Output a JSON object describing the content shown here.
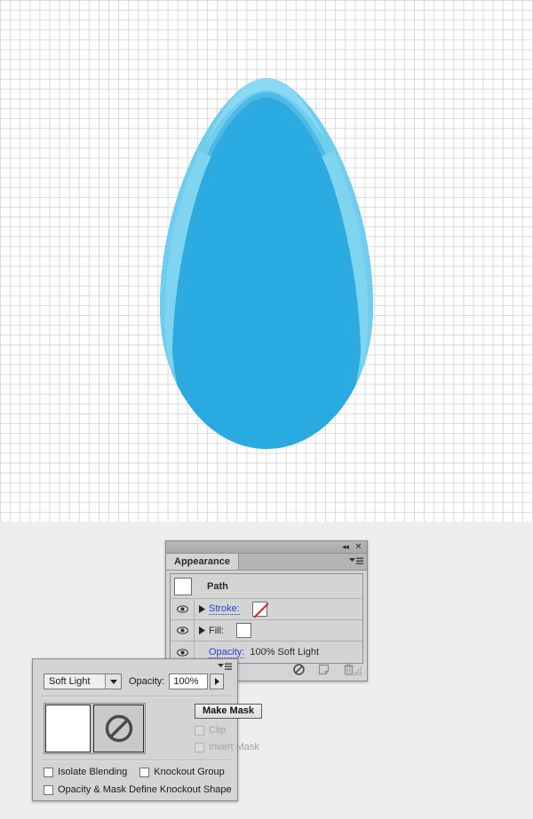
{
  "canvas": {
    "background_color": "#ffffff",
    "grid_color": "#d9d9d9",
    "grid_size_px": 11,
    "workspace_color": "#eeeeee"
  },
  "artwork": {
    "name": "egg-shape",
    "fill_color": "#29abe2",
    "highlight_color": "#6fcdee",
    "rim_color": "#4cc0ea",
    "description": "blue egg shape with light highlight rim"
  },
  "appearance_panel": {
    "titlebar": {
      "collapse_icon": "collapse-icon",
      "collapse_glyph": "◂◂",
      "close_icon": "close-icon",
      "close_glyph": "✕"
    },
    "tab_label": "Appearance",
    "menu_icon": "panel-menu-icon",
    "rows": [
      {
        "type": "object",
        "label": "Path",
        "has_thumbnail": true
      },
      {
        "type": "attribute",
        "label": "Stroke:",
        "linked": true,
        "visible": true,
        "expandable": true,
        "swatch": "none"
      },
      {
        "type": "attribute",
        "label": "Fill:",
        "linked": false,
        "visible": true,
        "expandable": true,
        "swatch": "white"
      },
      {
        "type": "attribute",
        "label": "Opacity:",
        "linked": true,
        "visible": true,
        "expandable": false,
        "value_text": "100% Soft Light"
      }
    ],
    "footer_icons": [
      {
        "name": "clear-appearance-icon",
        "glyph": "⊘"
      },
      {
        "name": "duplicate-item-icon",
        "glyph": "❐"
      },
      {
        "name": "delete-item-icon",
        "glyph": "Ὕ1"
      }
    ]
  },
  "transparency_panel": {
    "menu_icon": "panel-menu-icon",
    "blend_mode": {
      "label_value": "Soft Light",
      "arrow_glyph": "▼"
    },
    "opacity": {
      "label": "Opacity:",
      "value": "100%",
      "stepper_glyph": "▶"
    },
    "thumbnails": {
      "object_thumb_name": "object-thumbnail",
      "mask_thumb_name": "mask-thumbnail",
      "mask_glyph": "⊘"
    },
    "make_mask_button": "Make Mask",
    "clip_checkbox": {
      "label": "Clip",
      "checked": false,
      "disabled": true
    },
    "invert_mask_checkbox": {
      "label": "Invert Mask",
      "checked": false,
      "disabled": true
    },
    "isolate_blending_checkbox": {
      "label": "Isolate Blending",
      "checked": false
    },
    "knockout_group_checkbox": {
      "label": "Knockout Group",
      "checked": false
    },
    "opacity_mask_checkbox": {
      "label": "Opacity & Mask Define Knockout Shape",
      "checked": false
    }
  }
}
